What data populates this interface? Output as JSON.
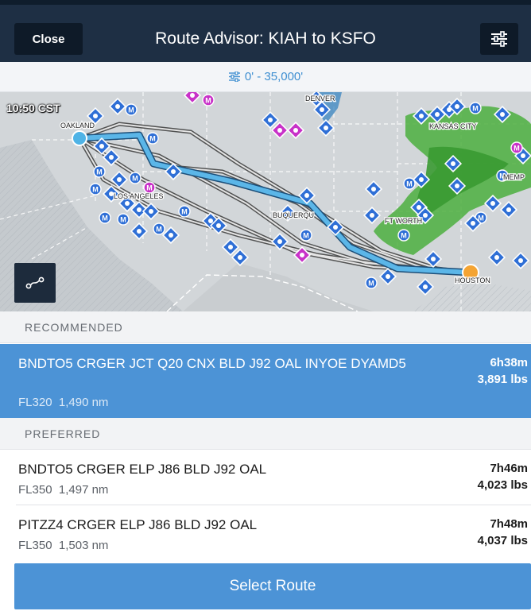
{
  "header": {
    "close_label": "Close",
    "title": "Route Advisor: KIAH to KSFO",
    "settings_icon": "sliders-icon"
  },
  "altitude_filter": {
    "icon": "sliders-icon",
    "label": "0' - 35,000'"
  },
  "map": {
    "timestamp": "10:50 CST",
    "labels": {
      "oakland": "OAKLAND",
      "los_angeles": "LOS ANGELES",
      "denver": "DENVER",
      "albuquerque": "BUQUERQU",
      "kansas_city": "KANSAS CITY",
      "ft_worth": "FT WORTH",
      "memphis": "MEMP",
      "houston": "HOUSTON"
    },
    "route_toggle_icon": "route-icon",
    "colors": {
      "selected_route": "#5bb6e8",
      "alternate_route": "#444444",
      "origin_marker": "#f4a433",
      "destination_marker": "#4fb3e6",
      "airport_blue": "#2f6fd6",
      "airport_magenta": "#c832c8",
      "weather": "#4caf3e"
    }
  },
  "sections": {
    "recommended": "RECOMMENDED",
    "preferred": "PREFERRED"
  },
  "routes": {
    "recommended": [
      {
        "name": "BNDTO5 CRGER JCT Q20 CNX BLD J92 OAL INYOE DYAMD5",
        "flight_level": "FL320",
        "distance": "1,490 nm",
        "time": "6h38m",
        "fuel": "3,891 lbs",
        "selected": true
      }
    ],
    "preferred": [
      {
        "name": "BNDTO5 CRGER ELP J86 BLD J92 OAL",
        "flight_level": "FL350",
        "distance": "1,497 nm",
        "time": "7h46m",
        "fuel": "4,023 lbs"
      },
      {
        "name": "PITZZ4 CRGER ELP J86 BLD J92 OAL",
        "flight_level": "FL350",
        "distance": "1,503 nm",
        "time": "7h48m",
        "fuel": "4,037 lbs"
      }
    ]
  },
  "footer": {
    "select_label": "Select Route"
  }
}
